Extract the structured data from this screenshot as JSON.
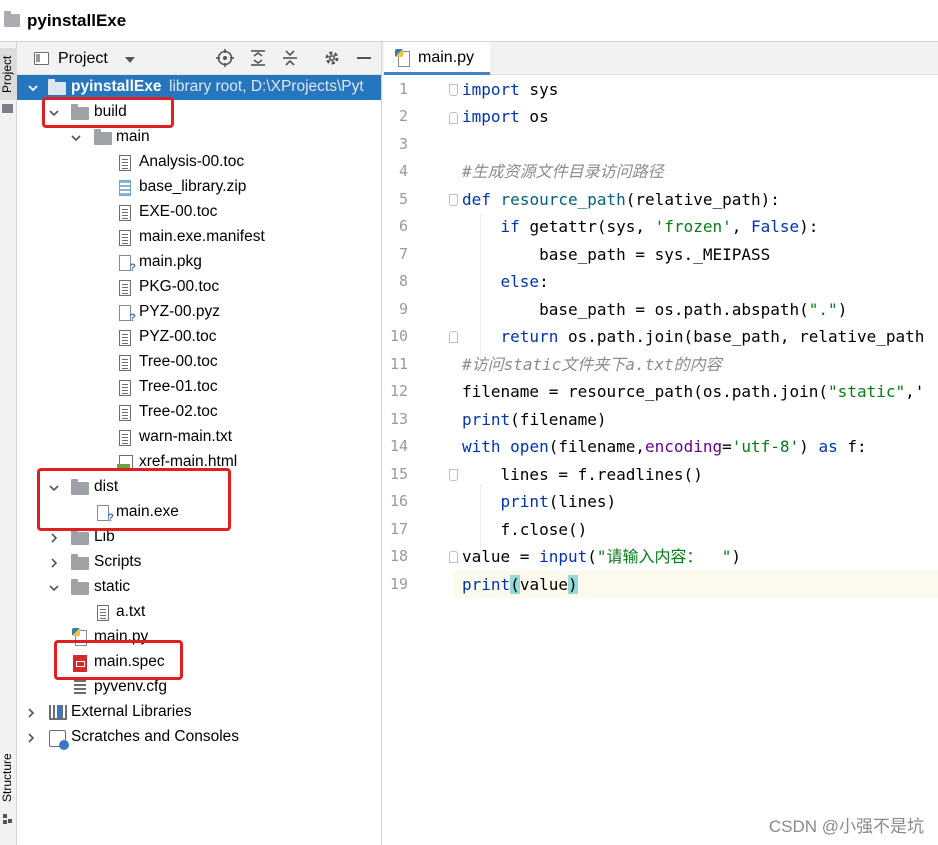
{
  "window": {
    "title": "pyinstallExe"
  },
  "stripe": {
    "project_tab": "Project",
    "structure_tab": "Structure"
  },
  "project_panel": {
    "header_label": "Project",
    "tree": [
      {
        "label": "pyinstallExe",
        "secondary": "library root,  D:\\XProjects\\Pyt",
        "type": "folder",
        "expanded": true,
        "selected": true
      },
      {
        "label": "build",
        "type": "folder",
        "expanded": true
      },
      {
        "label": "main",
        "type": "folder",
        "expanded": true
      },
      {
        "label": "Analysis-00.toc",
        "type": "file"
      },
      {
        "label": "base_library.zip",
        "type": "zip"
      },
      {
        "label": "EXE-00.toc",
        "type": "file"
      },
      {
        "label": "main.exe.manifest",
        "type": "file"
      },
      {
        "label": "main.pkg",
        "type": "unknown"
      },
      {
        "label": "PKG-00.toc",
        "type": "file"
      },
      {
        "label": "PYZ-00.pyz",
        "type": "unknown"
      },
      {
        "label": "PYZ-00.toc",
        "type": "file"
      },
      {
        "label": "Tree-00.toc",
        "type": "file"
      },
      {
        "label": "Tree-01.toc",
        "type": "file"
      },
      {
        "label": "Tree-02.toc",
        "type": "file"
      },
      {
        "label": "warn-main.txt",
        "type": "file"
      },
      {
        "label": "xref-main.html",
        "type": "html"
      },
      {
        "label": "dist",
        "type": "folder",
        "expanded": true
      },
      {
        "label": "main.exe",
        "type": "unknown"
      },
      {
        "label": "Lib",
        "type": "folder",
        "expanded": false
      },
      {
        "label": "Scripts",
        "type": "folder",
        "expanded": false
      },
      {
        "label": "static",
        "type": "folder",
        "expanded": true
      },
      {
        "label": "a.txt",
        "type": "file"
      },
      {
        "label": "main.py",
        "type": "python"
      },
      {
        "label": "main.spec",
        "type": "spec"
      },
      {
        "label": "pyvenv.cfg",
        "type": "cfg"
      },
      {
        "label": "External Libraries",
        "type": "library",
        "expanded": false
      },
      {
        "label": "Scratches and Consoles",
        "type": "scratch",
        "expanded": false
      }
    ]
  },
  "editor": {
    "tab_label": "main.py",
    "line_numbers": [
      "1",
      "2",
      "3",
      "4",
      "5",
      "6",
      "7",
      "8",
      "9",
      "10",
      "11",
      "12",
      "13",
      "14",
      "15",
      "16",
      "17",
      "18",
      "19"
    ],
    "current_line": 19,
    "code": {
      "l1_kw": "import",
      "l1_rest": " sys",
      "l2_kw": "import",
      "l2_rest": " os",
      "l4_comment": "#生成资源文件目录访问路径",
      "l5_kw": "def",
      "l5_fn": "resource_path",
      "l5_rest": "(relative_path):",
      "l6_kw": "if",
      "l6_fn": "getattr",
      "l6_a": "(sys, ",
      "l6_str": "'frozen'",
      "l6_b": ", ",
      "l6_kw2": "False",
      "l6_c": "):",
      "l7_text": "base_path = sys._MEIPASS",
      "l8_kw": "else",
      "l8_rest": ":",
      "l9_a": "base_path = os.path.abspath(",
      "l9_str": "\".\"",
      "l9_b": ")",
      "l10_kw": "return",
      "l10_rest": " os.path.join(base_path, relative_path",
      "l11_comment": "#访问static文件夹下a.txt的内容",
      "l12_a": "filename = resource_path(os.path.join(",
      "l12_str": "\"static\"",
      "l12_b": ",'",
      "l13_fn": "print",
      "l13_rest": "(filename)",
      "l14_kw": "with",
      "l14_fn": "open",
      "l14_a": "(filename,",
      "l14_kwarg": "encoding",
      "l14_b": "=",
      "l14_str": "'utf-8'",
      "l14_c": ") ",
      "l14_kw2": "as",
      "l14_d": " f:",
      "l15_text": "lines = f.readlines()",
      "l16_fn": "print",
      "l16_rest": "(lines)",
      "l17_text": "f.close()",
      "l18_a": "value = ",
      "l18_fn": "input",
      "l18_b": "(",
      "l18_str": "\"请输入内容：  \"",
      "l18_c": ")",
      "l19_fn": "print",
      "l19_open": "(",
      "l19_mid": "value",
      "l19_close": ")"
    }
  },
  "watermark": "CSDN @小强不是坑",
  "colors": {
    "selection": "#2675bf",
    "highlight_box": "#e02020",
    "keyword": "#0033b3",
    "string": "#067d17",
    "comment": "#8c8c8c"
  }
}
